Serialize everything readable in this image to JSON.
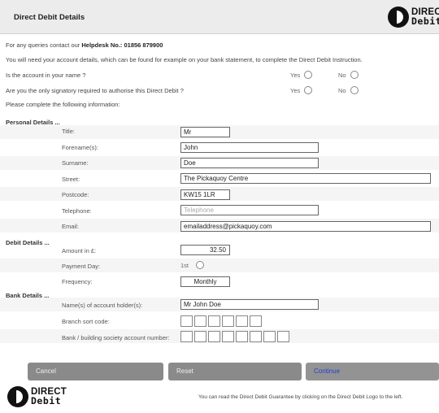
{
  "header": {
    "title": "Direct Debit Details"
  },
  "logo": {
    "line1": "DIRECT",
    "line2": "Debit"
  },
  "info": {
    "queries_prefix": "For any queries contact our",
    "helpdesk": "Helpdesk No.: 01856 879900",
    "account_details": "You will need your account details, which can be found for example on your bank statement, to complete the Direct Debit Instruction."
  },
  "questions": [
    {
      "text": "Is the account in your name ?",
      "yes": "Yes",
      "no": "No"
    },
    {
      "text": "Are you the only signatory required to authorise this Direct Debit ?",
      "yes": "Yes",
      "no": "No"
    }
  ],
  "instruction": "Please complete the following information:",
  "personal": {
    "heading": "Personal Details ...",
    "title_label": "Title:",
    "title_value": "Mr",
    "forename_label": "Forename(s):",
    "forename_value": "John",
    "surname_label": "Surname:",
    "surname_value": "Doe",
    "street_label": "Street:",
    "street_value": "The Pickaquoy Centre",
    "postcode_label": "Postcode:",
    "postcode_value": "KW15 1LR",
    "telephone_label": "Telephone:",
    "telephone_placeholder": "Telephone",
    "email_label": "Email:",
    "email_value": "emailaddress@pickaquoy.com"
  },
  "debit": {
    "heading": "Debit Details ...",
    "amount_label": "Amount in £:",
    "amount_value": "32.50",
    "payment_day_label": "Payment Day:",
    "payment_day_value": "1st",
    "frequency_label": "Frequency:",
    "frequency_value": "Monthly"
  },
  "bank": {
    "heading": "Bank Details ...",
    "holder_label": "Name(s) of account holder(s):",
    "holder_value": "Mr John Doe",
    "sort_label": "Branch sort code:",
    "account_label": "Bank / building society account number:"
  },
  "buttons": {
    "cancel": "Cancel",
    "reset": "Reset",
    "continue": "Continue"
  },
  "footer": {
    "text": "You can read the Direct Debit Guarantee by clicking on the Direct Debit Logo to the left."
  },
  "colors": {
    "header_bg": "#ececec",
    "button_bg": "#8a8a8a",
    "continue_text": "#2244cc"
  }
}
